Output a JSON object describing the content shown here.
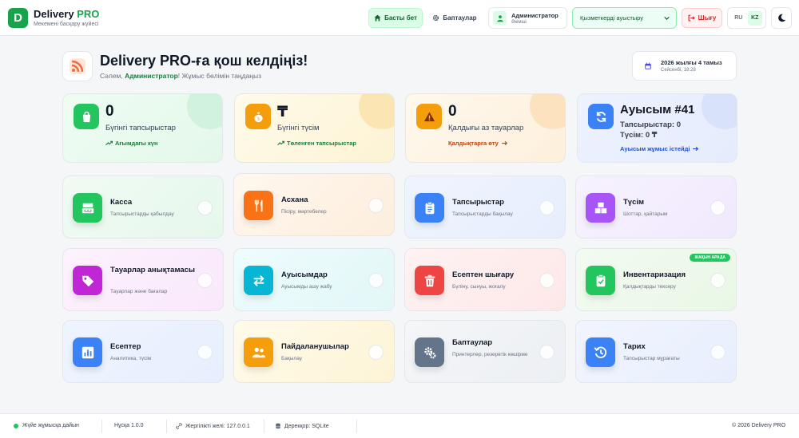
{
  "header": {
    "brand_letter": "D",
    "brand_name": "Delivery",
    "brand_pro": "PRO",
    "brand_sub": "Мекемені басқару жүйесі",
    "home_label": "Басты бет",
    "settings_label": "Баптаулар",
    "user_name": "Администратор",
    "user_role": "Әкімші",
    "staff_select": "Қызметкерді ауыстыру",
    "logout_label": "Шығу",
    "lang_ru": "RU",
    "lang_kz": "KZ",
    "active_lang": "KZ"
  },
  "welcome": {
    "title": "Delivery PRO-ға қош келдіңіз!",
    "greeting_prefix": "Сәлем, ",
    "user": "Администратор",
    "greeting_suffix": "! Жұмыс бөлімін таңдаңыз",
    "date": "2026 жылғы 4 тамыз",
    "time": "Сейсенбі, 18:28"
  },
  "stats": {
    "orders": {
      "value": "0",
      "label": "Бүгінгі тапсырыстар",
      "link": "Ағымдағы күн"
    },
    "revenue": {
      "value": "₸",
      "label": "Бүгінгі түсім",
      "link": "Төленген тапсырыстар"
    },
    "low_stock": {
      "value": "0",
      "label": "Қалдығы аз тауарлар",
      "link": "Қалдықтарға өту"
    },
    "shift": {
      "title": "Ауысым #41",
      "orders_line": "Тапсырыстар: 0",
      "revenue_line": "Түсім: 0 ₸",
      "link": "Ауысым жұмыс істейді"
    }
  },
  "tiles": [
    {
      "title": "Касса",
      "sub": "Тапсырыстарды қабылдау"
    },
    {
      "title": "Асхана",
      "sub": "Пісіру, мәртебелер"
    },
    {
      "title": "Тапсырыстар",
      "sub": "Тапсырыстарды бақылау"
    },
    {
      "title": "Түсім",
      "sub": "Шоттар, қайтарым"
    },
    {
      "title": "Тауарлар анықтамасы",
      "sub": "Тауарлар және бағалар"
    },
    {
      "title": "Ауысымдар",
      "sub": "Ауысымды ашу жабу"
    },
    {
      "title": "Есептен шығару",
      "sub": "Бүліну, сынуы, жоғалу"
    },
    {
      "title": "Инвентаризация",
      "sub": "Қалдықтарды тексеру",
      "badge": "ЖАҚЫН АРАДА"
    },
    {
      "title": "Есептер",
      "sub": "Аналитика, түсім"
    },
    {
      "title": "Пайдаланушылар",
      "sub": "Бақылау"
    },
    {
      "title": "Баптаулар",
      "sub": "Принтерлер, резервтік көшірме"
    },
    {
      "title": "Тарих",
      "sub": "Тапсырыстар мұрағаты"
    }
  ],
  "footer": {
    "status": "Жүйе жұмысқа дайын",
    "version": "Нұсқа 1.0.0",
    "network": "Жергілікті желі: 127.0.0.1",
    "database": "Дерекқор: SQLite",
    "copyright": "© 2026 Delivery PRO"
  },
  "colors": {
    "accent": "#16a34a",
    "danger": "#dc2626",
    "warning": "#f59e0b"
  }
}
